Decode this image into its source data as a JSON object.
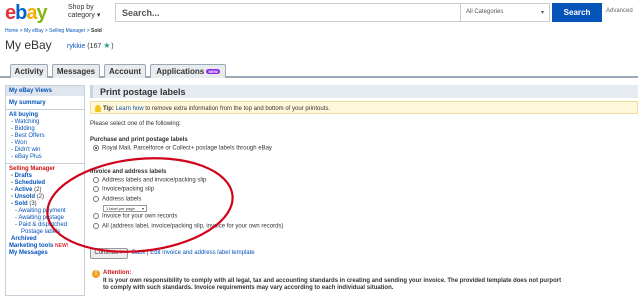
{
  "header": {
    "logo": [
      "e",
      "b",
      "a",
      "y"
    ],
    "shop_by": "Shop by category",
    "search_placeholder": "Search...",
    "category": "All Categories",
    "search_button": "Search",
    "advanced": "Advanced"
  },
  "breadcrumb": {
    "path": "Home > My eBay > Selling Manager > ",
    "current": "Sold"
  },
  "page": {
    "title": "My eBay",
    "username": "rykkie",
    "score": "(167",
    "score_end": ")"
  },
  "tabs": [
    {
      "label": "Activity"
    },
    {
      "label": "Messages"
    },
    {
      "label": "Account"
    },
    {
      "label": "Applications",
      "badge": "NEW"
    }
  ],
  "sidebar": {
    "views_header": "My eBay Views",
    "summary": "My summary",
    "all_buying": "All buying",
    "buying_items": [
      "Watching",
      "Bidding",
      "Best Offers",
      "Won",
      "Didn't win",
      "eBay Plus"
    ],
    "selling_manager": "Selling Manager",
    "selling_items": [
      {
        "label": "Drafts",
        "count": ""
      },
      {
        "label": "Scheduled",
        "count": ""
      },
      {
        "label": "Active",
        "count": "(2)"
      },
      {
        "label": "Unsold",
        "count": "(2)"
      },
      {
        "label": "Sold",
        "count": "(3)"
      }
    ],
    "sold_items": [
      "Awaiting payment",
      "Awaiting postage",
      "Paid & dispatched",
      "Postage labels"
    ],
    "archived": "Archived",
    "marketing_tools": "Marketing tools",
    "marketing_badge": "NEW!",
    "my_messages": "My Messages"
  },
  "main": {
    "title": "Print postage labels",
    "tip_label": "Tip:",
    "tip_link": "Learn how",
    "tip_text": " to remove extra information from the top and bottom of your printouts.",
    "instruction": "Please select one of the following:",
    "purchase_heading": "Purchase and print postage labels",
    "purchase_option": "Royal Mail, Parcelforce or Collect+ postage labels through eBay",
    "invoice_heading": "Invoice and address labels",
    "options": [
      "Address labels and invoice/packing slip",
      "Invoice/packing slip",
      "Address labels",
      "Invoice for your own records",
      "All (address label, invoice/packing slip, invoice for your own records)"
    ],
    "label_select": "1 label per page",
    "continue_button": "Continue >",
    "back_link": "Back",
    "edit_link": "Edit invoice and address label template",
    "attention_title": "Attention:",
    "attention_text": "It is your own responsibility to comply with all legal, tax and accounting standards in creating and sending your invoice. The provided template does not purport to comply with such standards. Invoice requirements may vary according to each individual situation."
  },
  "colors": {
    "accent": "#0654ba",
    "annotation": "#d0021b"
  }
}
